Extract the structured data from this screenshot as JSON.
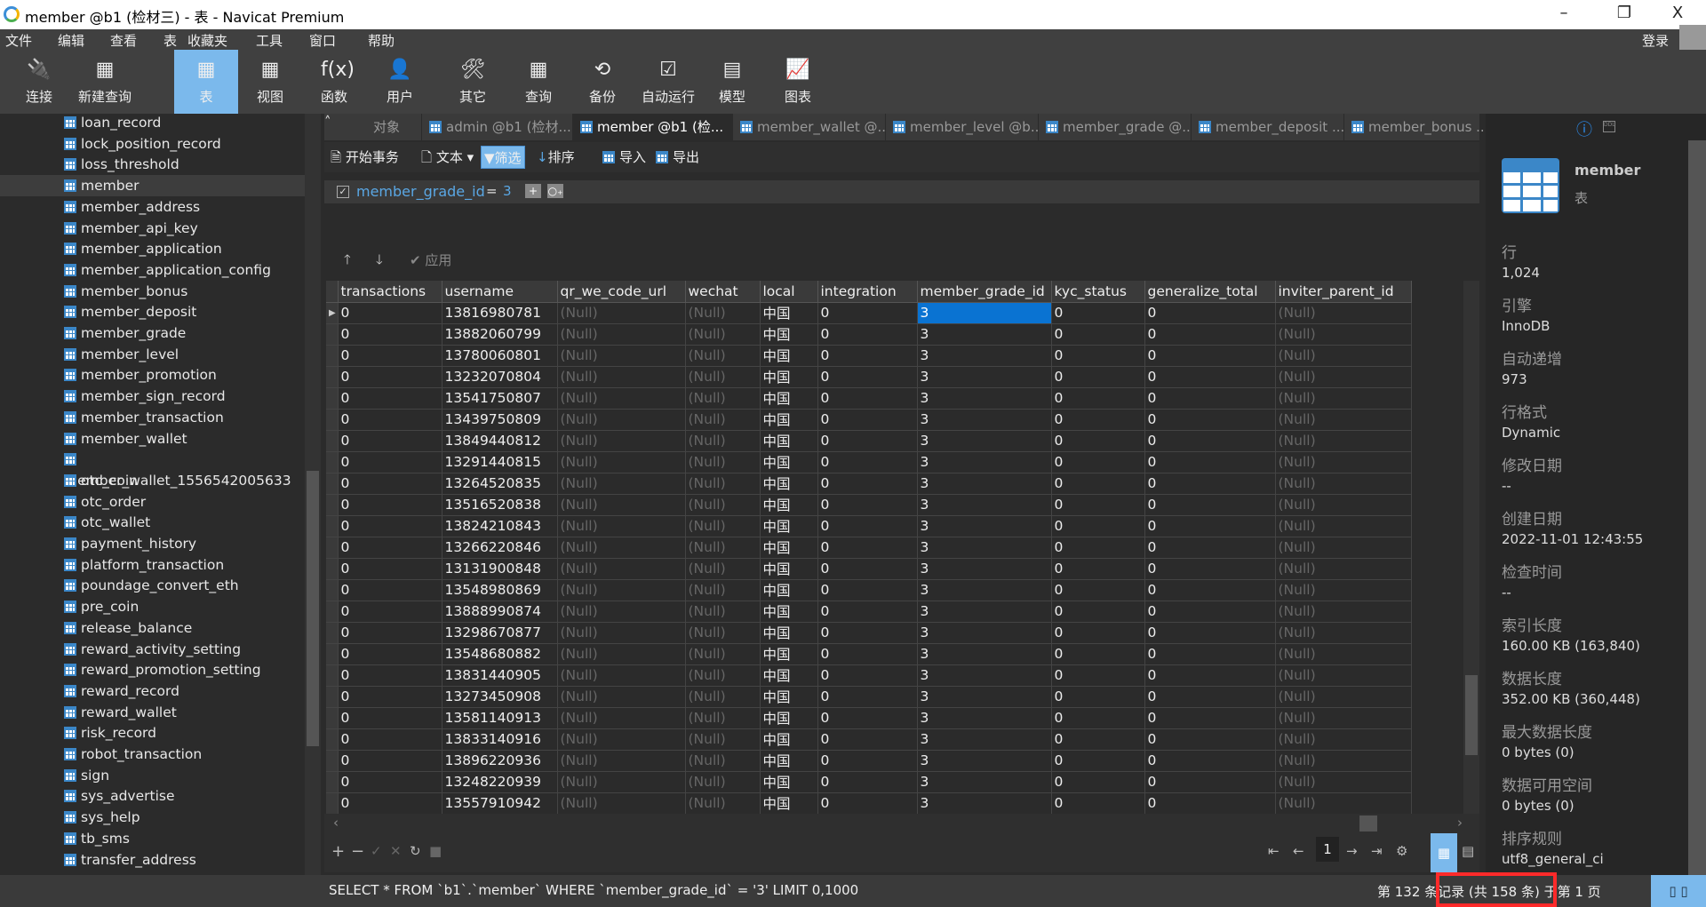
{
  "window": {
    "title": "member @b1 (检材三) - 表 - Navicat Premium",
    "minimize": "–",
    "restore": "❐",
    "close": "X"
  },
  "menu": [
    "文件",
    "编辑",
    "查看",
    "表",
    "收藏夹",
    "工具",
    "窗口",
    "帮助"
  ],
  "login": "登录",
  "toolbar": [
    {
      "label": "连接",
      "icon": "connection-plug-icon",
      "glyph": "🔌"
    },
    {
      "label": "新建查询",
      "icon": "new-query-icon",
      "glyph": "▦"
    },
    {
      "label": "表",
      "icon": "table-icon",
      "glyph": "▦",
      "active": true
    },
    {
      "label": "视图",
      "icon": "view-icon",
      "glyph": "▦"
    },
    {
      "label": "函数",
      "icon": "function-icon",
      "glyph": "f(x)"
    },
    {
      "label": "用户",
      "icon": "user-icon",
      "glyph": "👤"
    },
    {
      "label": "其它",
      "icon": "tools-icon",
      "glyph": "🛠"
    },
    {
      "label": "查询",
      "icon": "query-icon",
      "glyph": "▦"
    },
    {
      "label": "备份",
      "icon": "backup-icon",
      "glyph": "⟲"
    },
    {
      "label": "自动运行",
      "icon": "schedule-icon",
      "glyph": "☑"
    },
    {
      "label": "模型",
      "icon": "model-icon",
      "glyph": "▤"
    },
    {
      "label": "图表",
      "icon": "chart-icon",
      "glyph": "📈"
    }
  ],
  "sidebar": [
    "loan_record",
    "lock_position_record",
    "loss_threshold",
    "member",
    "member_address",
    "member_api_key",
    "member_application",
    "member_application_config",
    "member_bonus",
    "member_deposit",
    "member_grade",
    "member_level",
    "member_promotion",
    "member_sign_record",
    "member_transaction",
    "member_wallet",
    "member_wallet_1556542005633",
    "otc_coin",
    "otc_order",
    "otc_wallet",
    "payment_history",
    "platform_transaction",
    "poundage_convert_eth",
    "pre_coin",
    "release_balance",
    "reward_activity_setting",
    "reward_promotion_setting",
    "reward_record",
    "reward_wallet",
    "risk_record",
    "robot_transaction",
    "sign",
    "sys_advertise",
    "sys_help",
    "tb_sms",
    "transfer_address"
  ],
  "sidebar_selected": "member",
  "tabs": [
    "对象",
    "admin @b1 (检材...",
    "member @b1 (检...",
    "member_wallet @...",
    "member_level @b...",
    "member_grade @...",
    "member_deposit ...",
    "member_bonus ..."
  ],
  "active_tab": 2,
  "table_toolbar": {
    "begin_transaction": "开始事务",
    "text": "文本",
    "filter": "筛选",
    "sort": "排序",
    "import": "导入",
    "export": "导出"
  },
  "filter": {
    "field": "member_grade_id",
    "operator": "=",
    "value": "3",
    "checked": true,
    "apply": "应用"
  },
  "grid": {
    "columns": [
      "transactions",
      "username",
      "qr_we_code_url",
      "wechat",
      "local",
      "integration",
      "member_grade_id",
      "kyc_status",
      "generalize_total",
      "inviter_parent_id"
    ],
    "usernames": [
      "13816980781",
      "13882060799",
      "13780060801",
      "13232070804",
      "13541750807",
      "13439750809",
      "13849440812",
      "13291440815",
      "13264520835",
      "13516520838",
      "13824210843",
      "13266220846",
      "13131900848",
      "13548980869",
      "13888990874",
      "13298670877",
      "13548680882",
      "13831440905",
      "13273450908",
      "13581140913",
      "13833140916",
      "13896220936",
      "13248220939",
      "13557910942"
    ],
    "row_template": {
      "transactions": "0",
      "qr_we_code_url": "(Null)",
      "wechat": "(Null)",
      "local": "中国",
      "integration": "0",
      "member_grade_id": "3",
      "kyc_status": "0",
      "generalize_total": "0",
      "inviter_parent_id": "(Null)"
    }
  },
  "pager": {
    "page": "1"
  },
  "status": {
    "sql": "SELECT * FROM `b1`.`member` WHERE `member_grade_id` = '3' LIMIT 0,1000",
    "record": "第 132 条记录 (共 158 条) 于第 1 页"
  },
  "info": {
    "name": "member",
    "type": "表",
    "fields": [
      {
        "label": "行",
        "value": "1,024"
      },
      {
        "label": "引擎",
        "value": "InnoDB"
      },
      {
        "label": "自动递增",
        "value": "973"
      },
      {
        "label": "行格式",
        "value": "Dynamic"
      },
      {
        "label": "修改日期",
        "value": "--"
      },
      {
        "label": "创建日期",
        "value": "2022-11-01 12:43:55"
      },
      {
        "label": "检查时间",
        "value": "--"
      },
      {
        "label": "索引长度",
        "value": "160.00 KB (163,840)"
      },
      {
        "label": "数据长度",
        "value": "352.00 KB (360,448)"
      },
      {
        "label": "最大数据长度",
        "value": "0 bytes (0)"
      },
      {
        "label": "数据可用空间",
        "value": "0 bytes (0)"
      },
      {
        "label": "排序规则",
        "value": "utf8_general_ci"
      }
    ]
  },
  "colors": {
    "accent": "#7bb9ec",
    "selection": "#0a73d2",
    "highlight_box": "#ff2a2a"
  }
}
